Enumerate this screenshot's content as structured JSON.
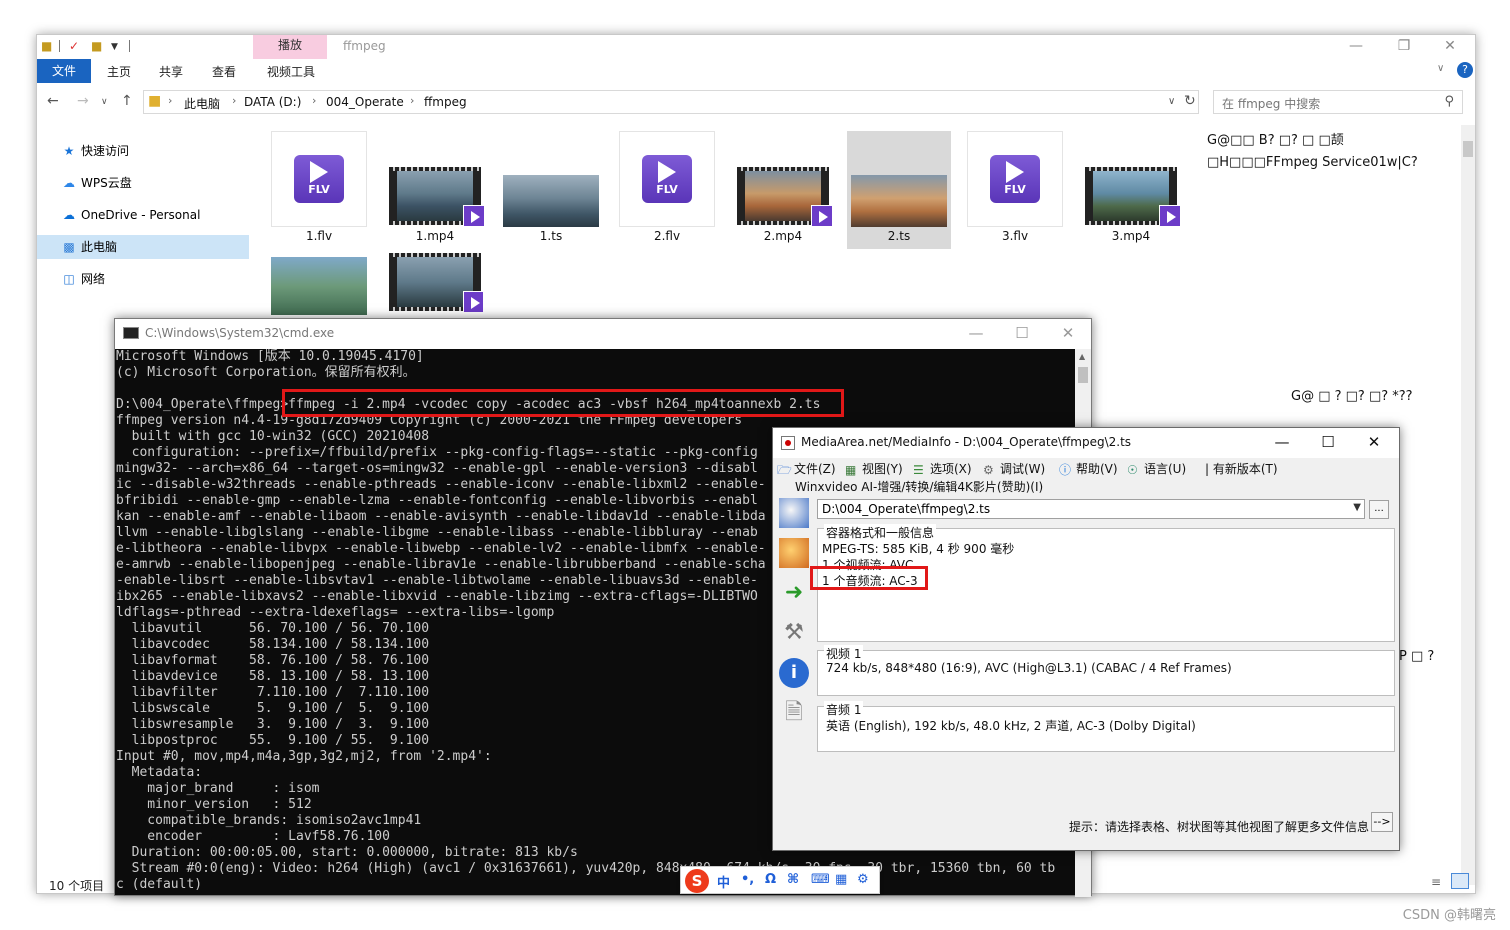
{
  "explorer": {
    "title": "ffmpeg",
    "context_tab_top": "播放",
    "ribbon_tabs": [
      "文件",
      "主页",
      "共享",
      "查看",
      "视频工具"
    ],
    "breadcrumb": [
      "此电脑",
      "DATA (D:)",
      "004_Operate",
      "ffmpeg"
    ],
    "search_placeholder": "在 ffmpeg 中搜索",
    "nav_items": [
      {
        "label": "快速访问",
        "icon": "star-icon"
      },
      {
        "label": "WPS云盘",
        "icon": "cloud-icon"
      },
      {
        "label": "OneDrive - Personal",
        "icon": "onedrive-icon"
      },
      {
        "label": "此电脑",
        "icon": "computer-icon"
      },
      {
        "label": "网络",
        "icon": "network-icon"
      }
    ],
    "files": [
      {
        "name": "1.flv",
        "kind": "flv"
      },
      {
        "name": "1.mp4",
        "kind": "mp4"
      },
      {
        "name": "1.ts",
        "kind": "image"
      },
      {
        "name": "2.flv",
        "kind": "flv"
      },
      {
        "name": "2.mp4",
        "kind": "mp4"
      },
      {
        "name": "2.ts",
        "kind": "image",
        "selected": true
      },
      {
        "name": "3.flv",
        "kind": "flv"
      },
      {
        "name": "3.mp4",
        "kind": "mp4"
      }
    ],
    "preview_text": [
      "G@□□  B? □?     □     □颉",
      "□H□□□FFmpeg         Service01w|C?",
      "G@  □   ?  □?     □?  *??",
      "P  □    ?"
    ],
    "status_count": "10 个项目",
    "accent_color": "#1a64c0"
  },
  "cmd": {
    "title": "C:\\Windows\\System32\\cmd.exe",
    "lines": [
      "Microsoft Windows [版本 10.0.19045.4170]",
      "(c) Microsoft Corporation。保留所有权利。",
      "",
      "D:\\004_Operate\\ffmpeg>ffmpeg -i 2.mp4 -vcodec copy -acodec ac3 -vbsf h264_mp4toannexb 2.ts",
      "ffmpeg version n4.4-19-g8d172d9409 Copyright (c) 2000-2021 the FFmpeg developers",
      "  built with gcc 10-win32 (GCC) 20210408",
      "  configuration: --prefix=/ffbuild/prefix --pkg-config-flags=--static --pkg-config",
      "mingw32- --arch=x86_64 --target-os=mingw32 --enable-gpl --enable-version3 --disabl",
      "ic --disable-w32threads --enable-pthreads --enable-iconv --enable-libxml2 --enable-",
      "bfribidi --enable-gmp --enable-lzma --enable-fontconfig --enable-libvorbis --enabl",
      "kan --enable-amf --enable-libaom --enable-avisynth --enable-libdav1d --enable-libda",
      "llvm --enable-libglslang --enable-libgme --enable-libass --enable-libbluray --enab",
      "e-libtheora --enable-libvpx --enable-libwebp --enable-lv2 --enable-libmfx --enable-",
      "e-amrwb --enable-libopenjpeg --enable-librav1e --enable-librubberband --enable-scha",
      "-enable-libsrt --enable-libsvtav1 --enable-libtwolame --enable-libuavs3d --enable-",
      "ibx265 --enable-libxavs2 --enable-libxvid --enable-libzimg --extra-cflags=-DLIBTWO",
      "ldflags=-pthread --extra-ldexeflags= --extra-libs=-lgomp",
      "  libavutil      56. 70.100 / 56. 70.100",
      "  libavcodec     58.134.100 / 58.134.100",
      "  libavformat    58. 76.100 / 58. 76.100",
      "  libavdevice    58. 13.100 / 58. 13.100",
      "  libavfilter     7.110.100 /  7.110.100",
      "  libswscale      5.  9.100 /  5.  9.100",
      "  libswresample   3.  9.100 /  3.  9.100",
      "  libpostproc    55.  9.100 / 55.  9.100",
      "Input #0, mov,mp4,m4a,3gp,3g2,mj2, from '2.mp4':",
      "  Metadata:",
      "    major_brand     : isom",
      "    minor_version   : 512",
      "    compatible_brands: isomiso2avc1mp41",
      "    encoder         : Lavf58.76.100",
      "  Duration: 00:00:05.00, start: 0.000000, bitrate: 813 kb/s",
      "  Stream #0:0(eng): Video: h264 (High) (avc1 / 0x31637661), yuv420p, 848x480, 674 kb/s, 30 fps, 30 tbr, 15360 tbn, 60 tb",
      "c (default)"
    ]
  },
  "mediainfo": {
    "title": "MediaArea.net/MediaInfo - D:\\004_Operate\\ffmpeg\\2.ts",
    "menus": [
      "文件(Z)",
      "视图(Y)",
      "选项(X)",
      "调试(W)",
      "帮助(V)",
      "语言(U)",
      "| 有新版本(T)"
    ],
    "submenu": "Winxvideo AI-增强/转换/编辑4K影片(赞助)(I)",
    "path": "D:\\004_Operate\\ffmpeg\\2.ts",
    "general_header": "容器格式和一般信息",
    "general_lines": [
      "MPEG-TS: 585 KiB, 4 秒 900 毫秒",
      "1 个视频流: AVC",
      "1 个音频流: AC-3"
    ],
    "video_header": "视频 1",
    "video_detail": "724 kb/s, 848*480 (16:9), AVC (High@L3.1) (CABAC / 4 Ref Frames)",
    "audio_header": "音频 1",
    "audio_detail": "英语 (English), 192 kb/s, 48.0 kHz, 2 声道, AC-3 (Dolby Digital)",
    "hint": "提示：请选择表格、树状图等其他视图了解更多文件信息",
    "arrow_label": "-->",
    "browse_label": "..."
  },
  "ime": {
    "logo": "S",
    "items": [
      "中",
      "•,",
      "Ω",
      "⌘",
      "⌨",
      "▦",
      "⚙"
    ]
  },
  "watermark": "CSDN @韩曙亮",
  "highlight_color": "#e11818"
}
